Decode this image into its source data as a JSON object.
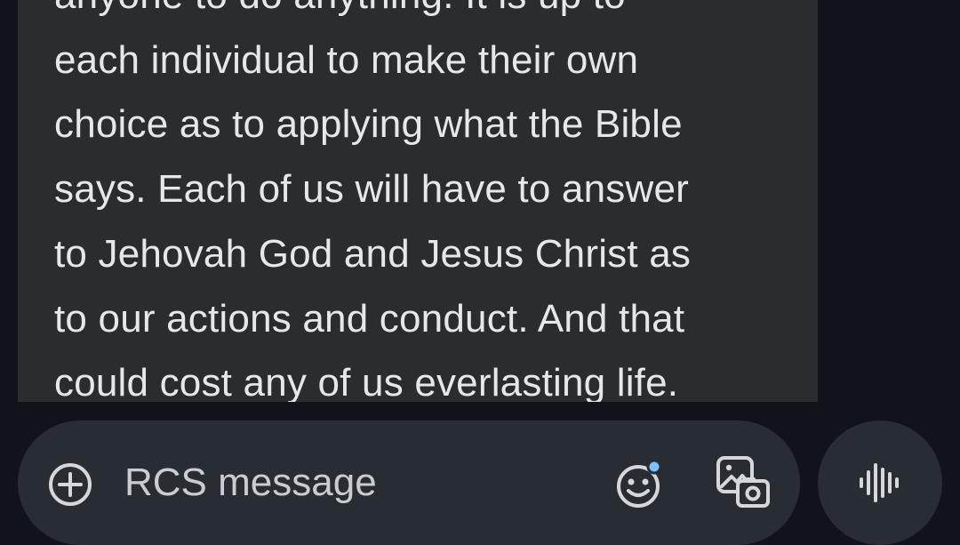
{
  "message": {
    "lines": [
      "anyone to do anything. It is up to",
      "each individual to make their own",
      "choice as to applying what the Bible",
      "says. Each of us will have to answer",
      "to Jehovah God and Jesus Christ as",
      "to our actions and conduct. And that",
      "could cost any of us everlasting life."
    ]
  },
  "composer": {
    "placeholder": "RCS message",
    "value": ""
  },
  "icons": {
    "add": "add-circle-icon",
    "emoji": "emoji-icon",
    "gallery": "gallery-icon",
    "voice": "voice-message-icon"
  },
  "colors": {
    "background": "#10141a",
    "bubble": "#2b2c30",
    "composer": "#282c33",
    "text": "#e6e7ea",
    "icon": "#d5d7da",
    "notification_dot": "#7cc2ff"
  }
}
